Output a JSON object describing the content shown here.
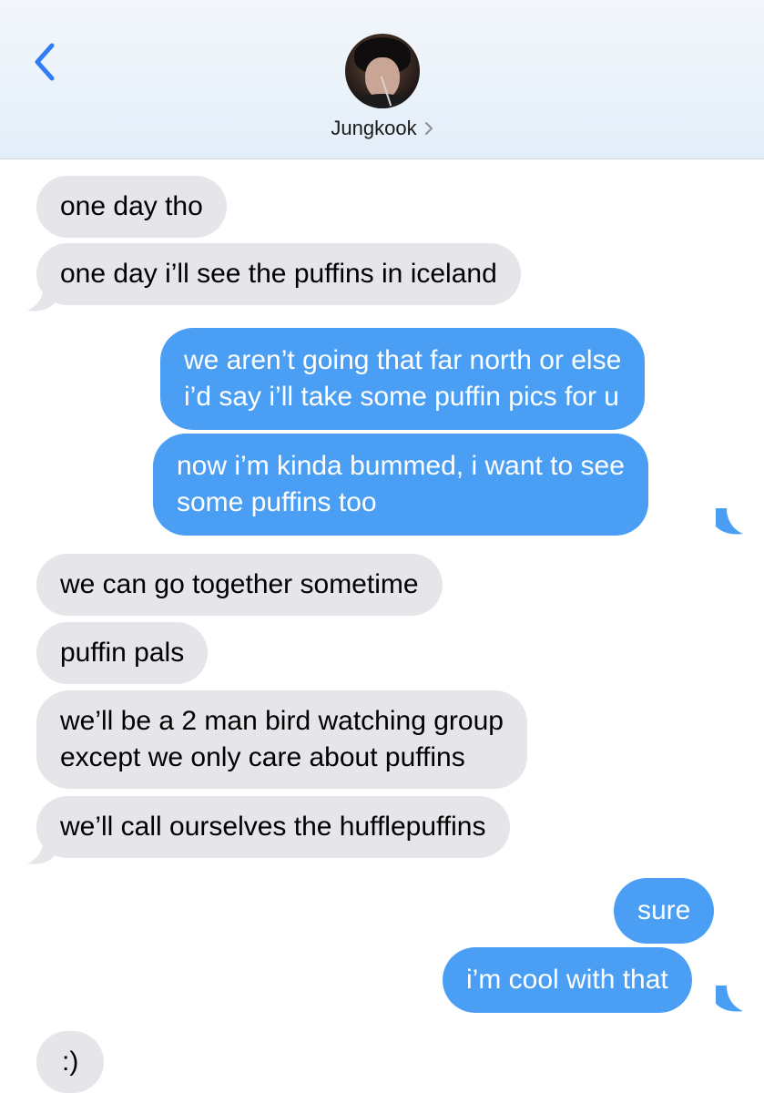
{
  "header": {
    "back_icon": "chevron-left-icon",
    "contact_name": "Jungkook",
    "contact_chevron": "chevron-right-icon"
  },
  "colors": {
    "header_bg": "#e7f0f9",
    "accent": "#2f7cf6",
    "sent_bubble": "#4a9ff5",
    "received_bubble": "#e5e5ea"
  },
  "messages": [
    {
      "sender": "contact",
      "text": "one day tho"
    },
    {
      "sender": "contact",
      "text": "one day i’ll see the puffins in iceland"
    },
    {
      "sender": "me",
      "text": "we aren’t going that far north or else\ni’d say i’ll take some puffin pics for u"
    },
    {
      "sender": "me",
      "text": "now i’m kinda bummed, i want to see\nsome puffins too"
    },
    {
      "sender": "contact",
      "text": "we can go together sometime"
    },
    {
      "sender": "contact",
      "text": "puffin pals"
    },
    {
      "sender": "contact",
      "text": "we’ll be a 2 man bird watching group\nexcept we only care about puffins"
    },
    {
      "sender": "contact",
      "text": "we’ll call ourselves the hufflepuffins"
    },
    {
      "sender": "me",
      "text": "sure"
    },
    {
      "sender": "me",
      "text": "i’m cool with that"
    },
    {
      "sender": "contact",
      "text": ":)"
    }
  ]
}
